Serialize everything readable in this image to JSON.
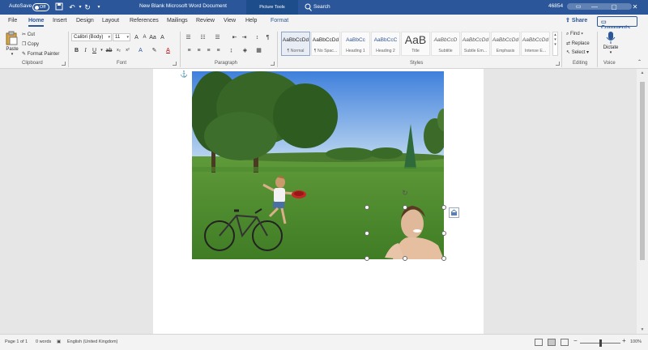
{
  "titlebar": {
    "autosave_label": "AutoSave",
    "autosave_state": "Off",
    "document_title": "New Blank Microsoft Word Document",
    "context_tab_group": "Picture Tools",
    "search_placeholder": "Search",
    "user_number": "46854",
    "accent_color": "#2b579a"
  },
  "tabs": [
    "File",
    "Home",
    "Insert",
    "Design",
    "Layout",
    "References",
    "Mailings",
    "Review",
    "View",
    "Help",
    "Format"
  ],
  "active_tab": "Home",
  "actions": {
    "share": "Share",
    "comments": "Comments"
  },
  "clipboard": {
    "paste": "Paste",
    "cut": "Cut",
    "copy": "Copy",
    "format_painter": "Format Painter",
    "group_label": "Clipboard"
  },
  "font": {
    "font_name": "Calibri (Body)",
    "font_size": "11",
    "group_label": "Font"
  },
  "paragraph": {
    "group_label": "Paragraph"
  },
  "styles": {
    "group_label": "Styles",
    "items": [
      {
        "preview": "AaBbCcDd",
        "name": "¶ Normal"
      },
      {
        "preview": "AaBbCcDd",
        "name": "¶ No Spac..."
      },
      {
        "preview": "AaBbCc",
        "name": "Heading 1"
      },
      {
        "preview": "AaBbCcC",
        "name": "Heading 2"
      },
      {
        "preview": "AaB",
        "name": "Title"
      },
      {
        "preview": "AaBbCcD",
        "name": "Subtitle"
      },
      {
        "preview": "AaBbCcDd",
        "name": "Subtle Em..."
      },
      {
        "preview": "AaBbCcDd",
        "name": "Emphasis"
      },
      {
        "preview": "AaBbCcDd",
        "name": "Intense E..."
      }
    ]
  },
  "editing": {
    "find": "Find",
    "replace": "Replace",
    "select": "Select",
    "group_label": "Editing"
  },
  "voice": {
    "dictate": "Dictate",
    "group_label": "Voice"
  },
  "statusbar": {
    "page": "Page 1 of 1",
    "words": "0 words",
    "language": "English (United Kingdom)",
    "zoom": "100%"
  }
}
